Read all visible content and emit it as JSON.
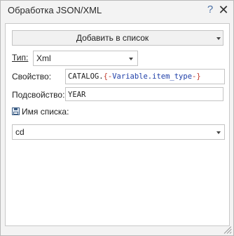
{
  "window": {
    "title": "Обработка JSON/XML",
    "help_glyph": "?",
    "close_glyph": "✕"
  },
  "action": {
    "selected": "Добавить в список"
  },
  "type": {
    "label": "Тип:",
    "selected": "Xml"
  },
  "property": {
    "label": "Свойство:",
    "prefix": "CATALOG.",
    "brace_open": "{-",
    "variable": "Variable.item_type",
    "brace_close": "-}"
  },
  "subproperty": {
    "label": "Подсвойство:",
    "value": "YEAR"
  },
  "list": {
    "label": "Имя списка:",
    "selected": "cd",
    "icon": "save-icon"
  },
  "colors": {
    "variable": "#1f3fa8",
    "brace": "#c0392b",
    "help": "#4a6fa5"
  }
}
